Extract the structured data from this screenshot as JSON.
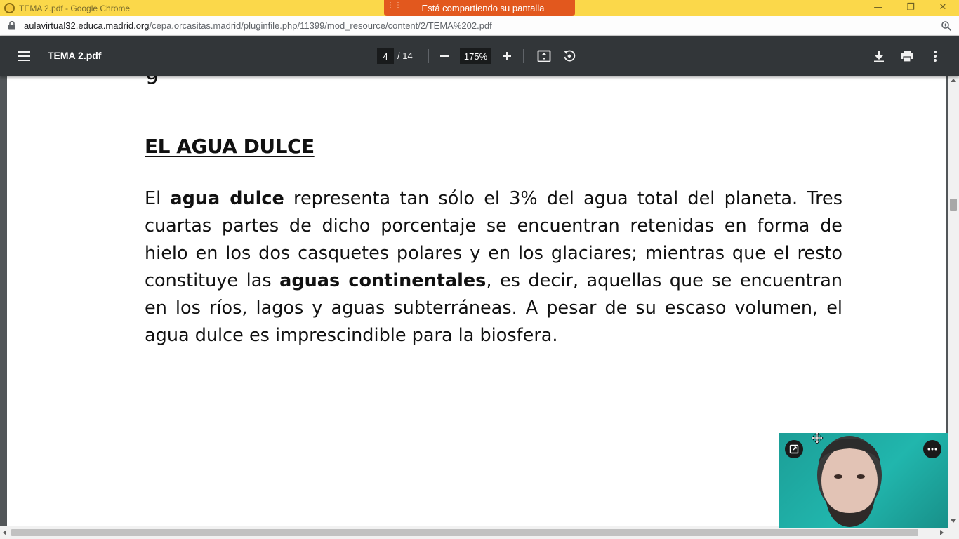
{
  "window": {
    "title": "TEMA 2.pdf - Google Chrome",
    "share_banner": "Está compartiendo su pantalla",
    "controls": {
      "minimize": "—",
      "restore": "❐",
      "close": "✕"
    }
  },
  "address_bar": {
    "domain": "aulavirtual32.educa.madrid.org",
    "path": "/cepa.orcasitas.madrid/pluginfile.php/11399/mod_resource/content/2/TEMA%202.pdf"
  },
  "pdf_toolbar": {
    "title": "TEMA 2.pdf",
    "current_page": "4",
    "total_pages": "/ 14",
    "zoom": "175%"
  },
  "document": {
    "top_fragment": "g",
    "heading": "EL AGUA DULCE",
    "paragraph": {
      "part1": "El ",
      "bold1": "agua dulce",
      "part2": " representa tan sólo el 3% del agua total del planeta. Tres cuartas partes de dicho porcentaje se encuentran retenidas en forma de hielo en los dos casquetes polares y en los glaciares; mientras que el resto constituye las ",
      "bold2": "aguas continentales",
      "part3": ", es decir, aquellas que se encuentran en los ríos, lagos y aguas subterráneas. A pesar de su escaso volumen, el agua dulce es imprescindible para la biosfera."
    }
  },
  "icons": {
    "app": "chrome-icon",
    "lock": "lock-icon",
    "zoom": "zoom-icon",
    "menu": "hamburger-menu-icon",
    "zoom_out": "minus-icon",
    "zoom_in": "plus-icon",
    "fit": "fit-to-page-icon",
    "rotate": "rotate-icon",
    "download": "download-icon",
    "print": "print-icon",
    "more": "more-vert-icon"
  },
  "colors": {
    "titlebar": "#fbd84a",
    "share_banner": "#e2581e",
    "pdf_toolbar": "#323639",
    "viewer_bg": "#525659",
    "video_bg": "#21b6ad"
  }
}
